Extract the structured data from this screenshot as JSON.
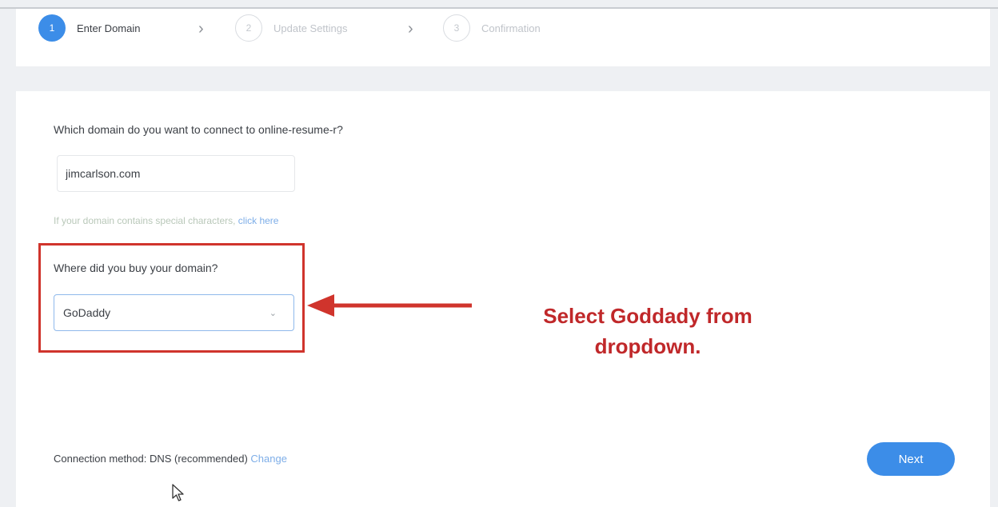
{
  "stepper": {
    "steps": [
      {
        "number": "1",
        "label": "Enter Domain",
        "state": "active"
      },
      {
        "number": "2",
        "label": "Update Settings",
        "state": "inactive"
      },
      {
        "number": "3",
        "label": "Confirmation",
        "state": "inactive"
      }
    ]
  },
  "form": {
    "question": "Which domain do you want to connect to online-resume-r?",
    "domain_value": "jimcarlson.com",
    "special_note": "If your domain contains special characters,",
    "special_link": "click here",
    "provider_label": "Where did you buy your domain?",
    "provider_value": "GoDaddy"
  },
  "annotation": {
    "line1": "Select Goddady from",
    "line2": "dropdown.",
    "color": "#c0282a"
  },
  "footer": {
    "connection_prefix": "Connection method: DNS (recommended)",
    "connection_link": "Change",
    "next_label": "Next"
  },
  "colors": {
    "accent": "#3c8de8",
    "highlight": "#d0342c"
  }
}
